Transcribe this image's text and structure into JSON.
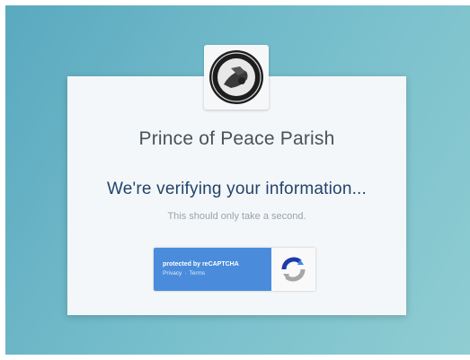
{
  "org_name": "Prince of Peace Parish",
  "verify": {
    "title": "We're verifying your information...",
    "subtitle": "This should only take a second."
  },
  "recaptcha": {
    "protected_label": "protected by reCAPTCHA",
    "privacy_link": "Privacy",
    "separator": "·",
    "terms_link": "Terms"
  },
  "colors": {
    "background_gradient": [
      "#5aa9bf",
      "#8fcdd2"
    ],
    "heading": "#22446a",
    "recaptcha_blue": "#4a8cdb"
  },
  "icons": {
    "logo": "parish-seal-icon",
    "recaptcha": "recaptcha-logo-icon"
  }
}
